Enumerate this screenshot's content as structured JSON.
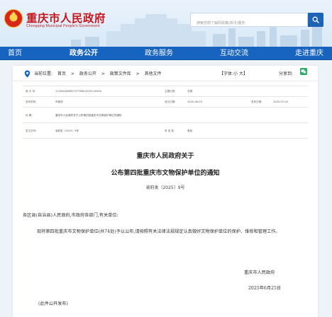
{
  "header": {
    "site_title": "重庆市人民政府",
    "site_subtitle": "Chongqing Municipal People's Government",
    "search_placeholder": "搜索您想了解的政策/资讯/服务"
  },
  "nav": {
    "items": [
      "首页",
      "政务公开",
      "政务服务",
      "互动交流",
      "走进重庆"
    ],
    "active": "政务公开"
  },
  "breadcrumb": {
    "prefix": "当前位置:",
    "items": [
      "首页",
      "政务公开",
      "政策文件库",
      "其他文件"
    ],
    "separator": ">"
  },
  "font_size": {
    "label": "【字体:",
    "small": "小",
    "large": "大",
    "close": "】"
  },
  "share": {
    "label": "分享到:"
  },
  "meta": {
    "row1": {
      "l1": "索  引  号:",
      "v1": "11500000MB1757786L/2025-00004",
      "l2": "主题分类:",
      "v2": "文物"
    },
    "row2": {
      "l1": "发布机构:",
      "v1": "市政府",
      "l2": "成文日期:",
      "v2": "2025-06-25",
      "l3": "发布日期:",
      "v3": "2025-07-04"
    },
    "row3": {
      "l1": "标      题:",
      "v1": "重庆市人民政府关于公布第四批重庆市文物保护单位的通知"
    },
    "row4": {
      "l1": "发文字号:",
      "v1": "渝府发〔2025〕9号",
      "l2": "有  效  性:",
      "v2": "有效"
    }
  },
  "article": {
    "title_line1": "重庆市人民政府关于",
    "title_line2": "公布第四批重庆市文物保护单位的通知",
    "doc_number": "渝府发〔2025〕9号",
    "salutation": "各区县(自治县)人民政府,市政府各部门,有关单位:",
    "body": "现将第四批重庆市文物保护单位(共74处)予以公布,请按照有关法律法规规定认真做好文物保护单位的保护、维修和管理工作。",
    "signer": "重庆市人民政府",
    "date": "2025年6月25日",
    "note": "(此件公开发布)"
  },
  "colors": {
    "brand_red": "#c4161c",
    "nav_blue": "#1763c0",
    "search_blue": "#1e63b4",
    "wechat_green": "#2aae67"
  }
}
